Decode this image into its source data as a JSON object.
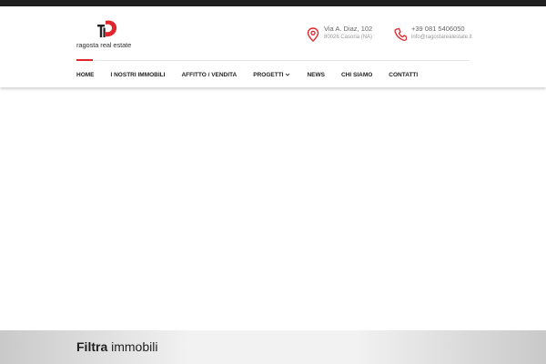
{
  "brand": {
    "name": "ragosta real estate",
    "accent_color": "#e0262c",
    "dark_color": "#1f1f1f"
  },
  "contact": {
    "address_line1": "Via A. Diaz, 102",
    "address_line2": "80026 Casoria (NA)",
    "address_icon": "map-pin-icon",
    "phone": "+39 081 5406050",
    "email": "info@ragostarealestate.it",
    "phone_icon": "phone-icon"
  },
  "nav": {
    "active": "HOME",
    "items": [
      {
        "label": "HOME"
      },
      {
        "label": "I NOSTRI IMMOBILI"
      },
      {
        "label": "AFFITTO / VENDITA"
      },
      {
        "label": "PROGETTI",
        "dropdown": true
      },
      {
        "label": "NEWS"
      },
      {
        "label": "CHI SIAMO"
      },
      {
        "label": "CONTATTI"
      }
    ]
  },
  "filter": {
    "title_bold": "Filtra",
    "title_rest": "immobili"
  }
}
